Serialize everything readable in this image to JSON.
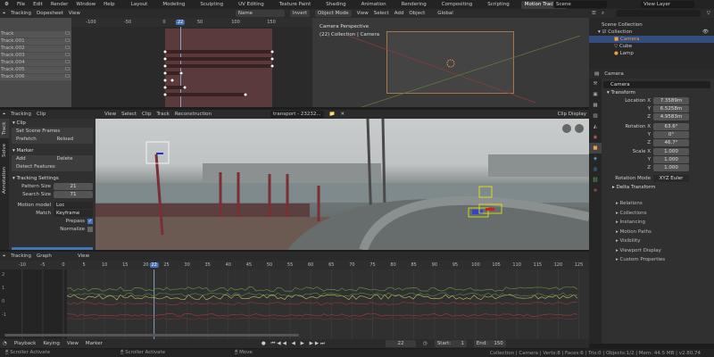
{
  "topbar": {
    "menus": [
      "File",
      "Edit",
      "Render",
      "Window",
      "Help"
    ],
    "workspaces": [
      "Layout",
      "Modeling",
      "Sculpting",
      "UV Editing",
      "Texture Paint",
      "Shading",
      "Animation",
      "Rendering",
      "Compositing",
      "Scripting",
      "Motion Tracking"
    ],
    "active_workspace": "Motion Tracking",
    "add": "+",
    "scene": "Scene",
    "view_layer": "View Layer"
  },
  "dopesheet": {
    "mode": "Tracking",
    "type": "Dopesheet",
    "view": "View",
    "sort": "Name",
    "invert": "Invert",
    "ticks": [
      "-100",
      "-50",
      "0",
      "22",
      "50",
      "100",
      "150"
    ],
    "tracks": [
      "Track",
      "Track.001",
      "Track.002",
      "Track.003",
      "Track.004",
      "Track.005",
      "Track.006"
    ]
  },
  "viewport": {
    "mode": "Object Mode",
    "menus": [
      "View",
      "Select",
      "Add",
      "Object"
    ],
    "orientation": "Global",
    "title": "Camera Perspective",
    "subtitle": "(22) Collection | Camera"
  },
  "outliner": {
    "root": "Scene Collection",
    "collection": "Collection",
    "items": [
      "Camera",
      "Cube",
      "Lamp"
    ],
    "selected": "Camera"
  },
  "properties": {
    "object": "Camera",
    "datablock": "Camera",
    "transform": "Transform",
    "location": {
      "label": "Location X",
      "x": "7.3589m",
      "y": "6.5258m",
      "z": "4.9583m"
    },
    "rotation": {
      "label": "Rotation X",
      "x": "63.6°",
      "y": "0°",
      "z": "46.7°"
    },
    "scale": {
      "label": "Scale X",
      "x": "1.000",
      "y": "1.000",
      "z": "1.000"
    },
    "axes": [
      "Y",
      "Z"
    ],
    "rotation_mode_label": "Rotation Mode",
    "rotation_mode": "XYZ Euler",
    "delta": "Delta Transform",
    "sections": [
      "Relations",
      "Collections",
      "Instancing",
      "Motion Paths",
      "Visibility",
      "Viewport Display",
      "Custom Properties"
    ]
  },
  "clip": {
    "mode": "Tracking",
    "view_type": "Clip",
    "menus": [
      "View",
      "Select",
      "Clip",
      "Track",
      "Reconstruction"
    ],
    "clip_name": "transport - 23232...",
    "display": "Clip Display",
    "tabs": [
      "Track",
      "Solve",
      "Annotation"
    ],
    "clip_panel": "Clip",
    "set_scene_frames": "Set Scene Frames",
    "prefetch": "Prefetch",
    "reload": "Reload",
    "marker_panel": "Marker",
    "add": "Add",
    "delete": "Delete",
    "detect": "Detect Features",
    "settings_panel": "Tracking Settings",
    "pattern_label": "Pattern Size",
    "pattern": "21",
    "search_label": "Search Size",
    "search": "71",
    "motion_label": "Motion model",
    "motion": "Loc",
    "match_label": "Match",
    "match": "Keyframe",
    "prepass": "Prepass",
    "prepass_checked": true,
    "normalize": "Normalize",
    "normalize_checked": false
  },
  "graph": {
    "mode": "Tracking",
    "type": "Graph",
    "view": "View",
    "ticks": [
      "-10",
      "-5",
      "0",
      "5",
      "10",
      "15",
      "20",
      "22",
      "25",
      "30",
      "35",
      "40",
      "45",
      "50",
      "55",
      "60",
      "65",
      "70",
      "75",
      "80",
      "85",
      "90",
      "95",
      "100",
      "105",
      "110",
      "115",
      "120",
      "125"
    ],
    "yticks": [
      "2",
      "1",
      "0",
      "-1"
    ]
  },
  "timeline": {
    "menus": [
      "Playback",
      "Keying",
      "View",
      "Marker"
    ],
    "frame": "22",
    "start_label": "Start:",
    "start": "1",
    "end_label": "End:",
    "end": "150"
  },
  "status": {
    "left": "Scroller Activate",
    "mid": "Scroller Activate",
    "move": "Move",
    "info": "Collection | Camera | Verts:8 | Faces:6 | Tris:0 | Objects:1/2 | Mem: 44.5 MB | v2.80.74"
  }
}
